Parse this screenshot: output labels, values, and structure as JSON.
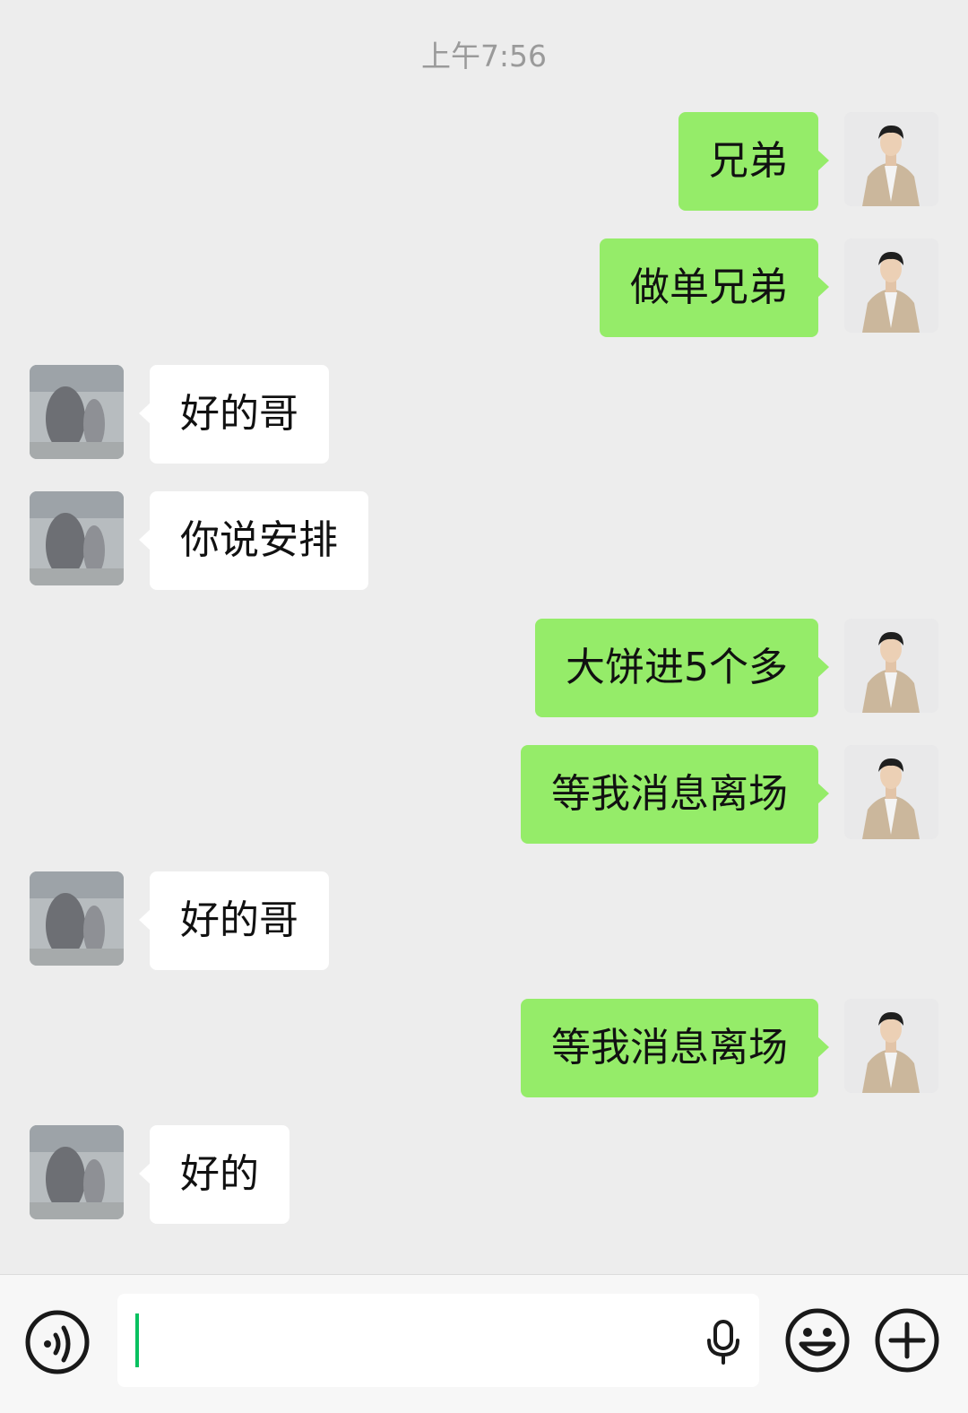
{
  "chat": {
    "timestamp": "上午7:56",
    "messages": [
      {
        "side": "right",
        "text": "兄弟"
      },
      {
        "side": "right",
        "text": "做单兄弟"
      },
      {
        "side": "left",
        "text": "好的哥"
      },
      {
        "side": "left",
        "text": "你说安排"
      },
      {
        "side": "right",
        "text": "大饼进5个多"
      },
      {
        "side": "right",
        "text": "等我消息离场"
      },
      {
        "side": "left",
        "text": "好的哥"
      },
      {
        "side": "right",
        "text": "等我消息离场"
      },
      {
        "side": "left",
        "text": "好的"
      }
    ]
  },
  "input_bar": {
    "value": "",
    "icons": [
      "voice-icon",
      "microphone-icon",
      "emoji-icon",
      "plus-icon"
    ]
  },
  "colors": {
    "background": "#ededed",
    "sent_bubble": "#95ec69",
    "received_bubble": "#ffffff",
    "cursor": "#07c160"
  }
}
